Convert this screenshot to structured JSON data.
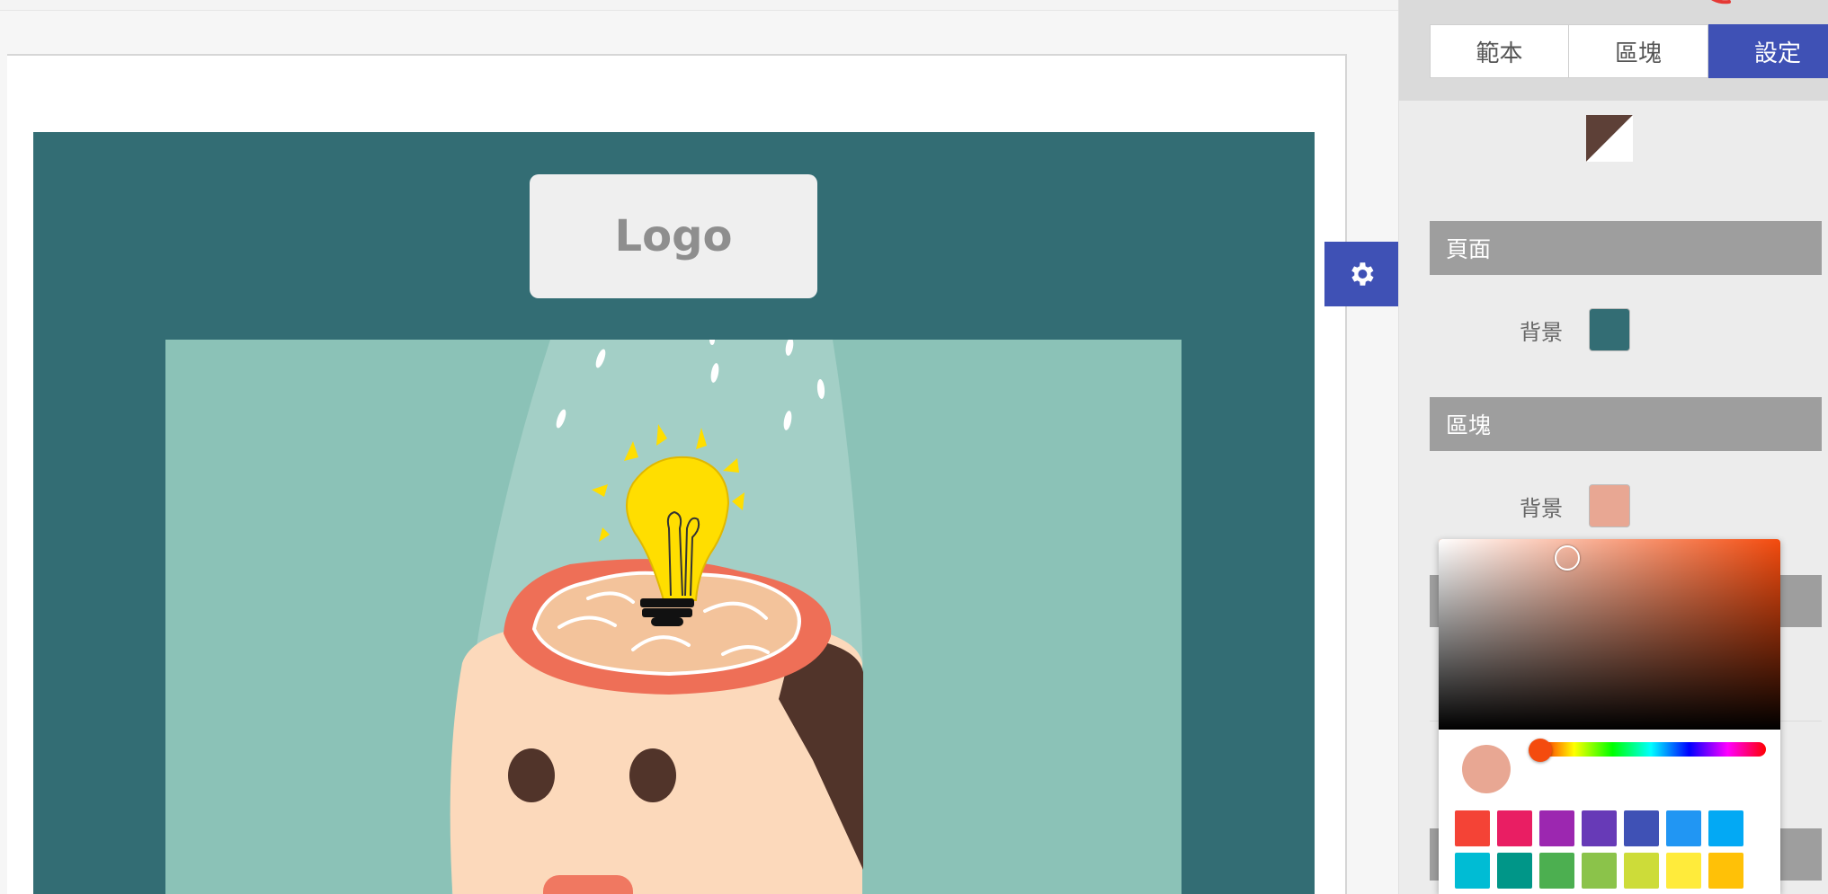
{
  "canvas": {
    "page_background": "#336d74",
    "logo_label": "Logo",
    "logo_box_color": "#efefef",
    "block_background": "#8bc2b7"
  },
  "panel": {
    "tabs": [
      {
        "label": "範本",
        "active": false
      },
      {
        "label": "區塊",
        "active": false
      },
      {
        "label": "設定",
        "active": true
      }
    ],
    "accent": "#3f51b5",
    "theme_swatch_colors": [
      "#5d4037",
      "#ffffff"
    ],
    "sections": [
      {
        "title": "頁面",
        "row_label": "背景",
        "color": "#336d74"
      },
      {
        "title": "區塊",
        "row_label": "背景",
        "color": "#e8a793"
      }
    ]
  },
  "color_picker": {
    "selected_color": "#e8a793",
    "hue_color": "#f44b0e",
    "swatches": [
      "#f44336",
      "#e91e63",
      "#9c27b0",
      "#673ab7",
      "#3f51b5",
      "#2196f3",
      "#03a9f4",
      "#00bcd4",
      "#009688",
      "#4caf50",
      "#8bc34a",
      "#cddc39",
      "#ffeb3b",
      "#ffc107"
    ]
  },
  "icons": {
    "settings_toggle": "gear-icon"
  }
}
